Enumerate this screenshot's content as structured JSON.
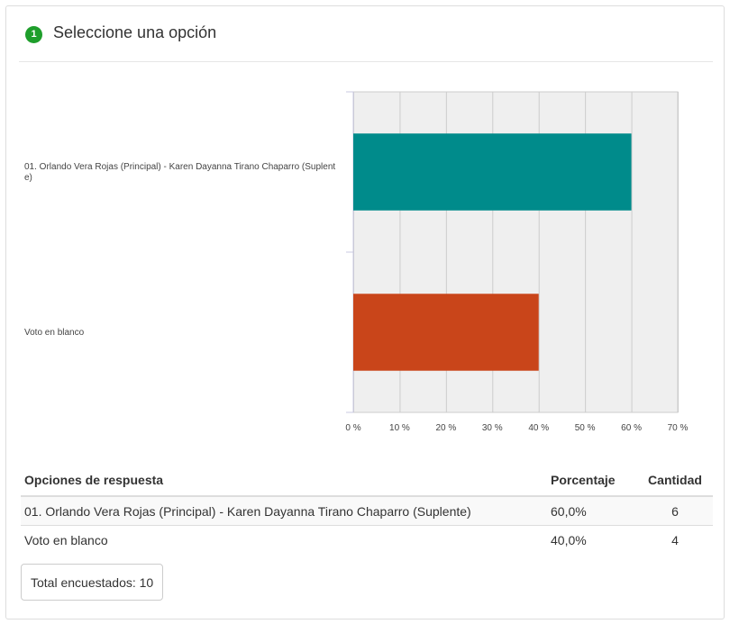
{
  "question": {
    "number": "1",
    "title": "Seleccione una opción"
  },
  "colors": {
    "accent_green": "#1e9e2b",
    "plot_bg": "#efefef",
    "grid": "#cccccc"
  },
  "chart_data": {
    "type": "bar",
    "orientation": "horizontal",
    "categories": [
      "01. Orlando Vera Rojas (Principal) - Karen Dayanna Tirano Chaparro (Suplente)",
      "Voto en blanco"
    ],
    "category_labels_wrapped": [
      [
        "01. Orlando Vera Rojas (Principal) - Karen Dayanna Tirano Chaparro (Suplent",
        "e)"
      ],
      [
        "Voto en blanco"
      ]
    ],
    "values": [
      60,
      40
    ],
    "colors": [
      "#008b8b",
      "#c9451a"
    ],
    "xlim": [
      0,
      70
    ],
    "xticks": [
      0,
      10,
      20,
      30,
      40,
      50,
      60,
      70
    ],
    "xtick_labels": [
      "0 %",
      "10 %",
      "20 %",
      "30 %",
      "40 %",
      "50 %",
      "60 %",
      "70 %"
    ],
    "grid": true,
    "legend": "none"
  },
  "table": {
    "headers": [
      "Opciones de respuesta",
      "Porcentaje",
      "Cantidad"
    ],
    "rows": [
      [
        "01. Orlando Vera Rojas (Principal) - Karen Dayanna Tirano Chaparro (Suplente)",
        "60,0%",
        "6"
      ],
      [
        "Voto en blanco",
        "40,0%",
        "4"
      ]
    ]
  },
  "total": "Total encuestados: 10"
}
